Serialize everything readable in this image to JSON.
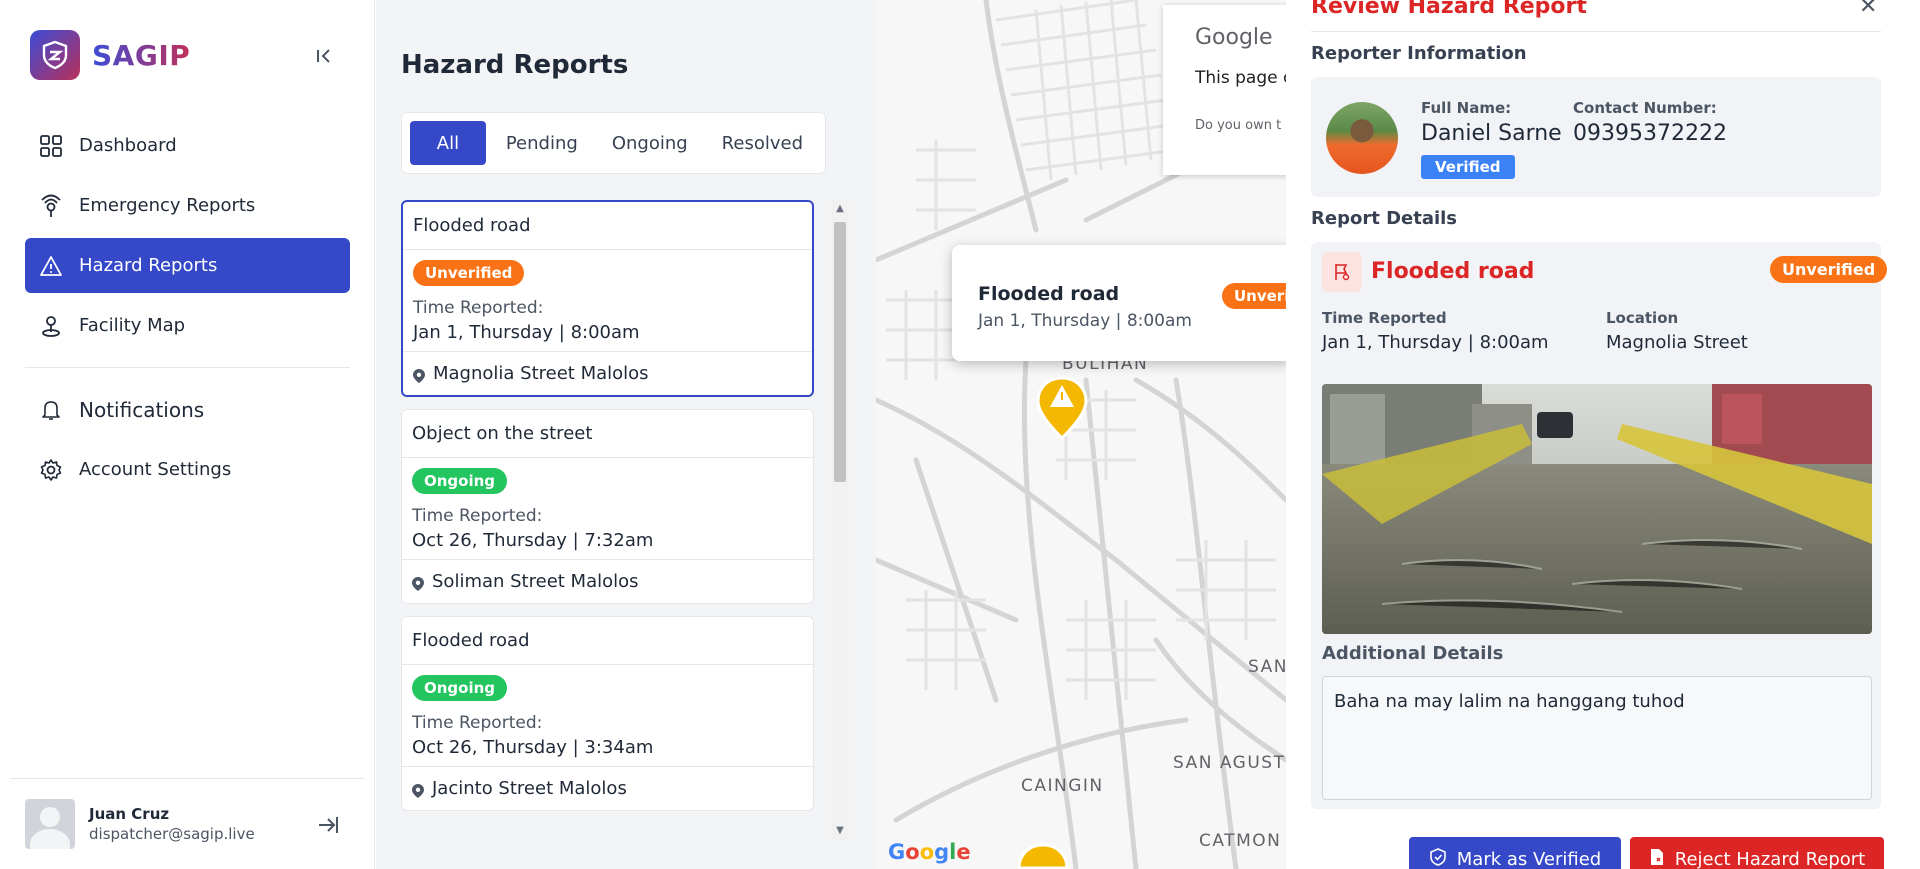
{
  "app": {
    "name": "SAGIP"
  },
  "sidebar": {
    "items": [
      {
        "label": "Dashboard",
        "icon": "dashboard-icon"
      },
      {
        "label": "Emergency Reports",
        "icon": "emergency-icon"
      },
      {
        "label": "Hazard Reports",
        "icon": "warning-icon",
        "active": true
      },
      {
        "label": "Facility Map",
        "icon": "map-pin-icon"
      }
    ],
    "secondary": [
      {
        "label": "Notifications",
        "icon": "bell-icon"
      },
      {
        "label": "Account Settings",
        "icon": "gear-icon"
      }
    ],
    "user": {
      "name": "Juan Cruz",
      "email": "dispatcher@sagip.live"
    }
  },
  "reports": {
    "title": "Hazard Reports",
    "tabs": [
      "All",
      "Pending",
      "Ongoing",
      "Resolved"
    ],
    "active_tab": "All",
    "time_label": "Time Reported:",
    "cards": [
      {
        "title": "Flooded road",
        "status": "Unverified",
        "time": "Jan 1, Thursday | 8:00am",
        "location": "Magnolia Street Malolos"
      },
      {
        "title": "Object on the street",
        "status": "Ongoing",
        "time": "Oct 26, Thursday | 7:32am",
        "location": "Soliman Street Malolos"
      },
      {
        "title": "Flooded road",
        "status": "Ongoing",
        "time": "Oct 26, Thursday | 3:34am",
        "location": "Jacinto Street Malolos"
      }
    ]
  },
  "map": {
    "dialog_logo": "Google",
    "dialog_msg": "This page c",
    "dialog_own": "Do you own t",
    "popup": {
      "title": "Flooded road",
      "time": "Jan 1, Thursday | 8:00am",
      "badge": "Unverifi"
    },
    "labels": [
      "BULIHAN",
      "CAINGIN",
      "SAN AGUST",
      "SAN",
      "CATMON"
    ],
    "watermark": "Google"
  },
  "review": {
    "title": "Review Hazard Report",
    "reporter_heading": "Reporter Information",
    "full_name_label": "Full Name:",
    "full_name": "Daniel Sarne",
    "verified_label": "Verified",
    "contact_label": "Contact Number:",
    "contact": "09395372222",
    "details_heading": "Report Details",
    "hazard_title": "Flooded road",
    "hazard_status": "Unverified",
    "time_label": "Time Reported",
    "time_value": "Jan 1, Thursday | 8:00am",
    "location_label": "Location",
    "location_value": "Magnolia Street",
    "additional_label": "Additional Details",
    "additional_text": "Baha na may lalim na hanggang tuhod",
    "verify_button": "Mark as Verified",
    "reject_button": "Reject Hazard Report"
  }
}
